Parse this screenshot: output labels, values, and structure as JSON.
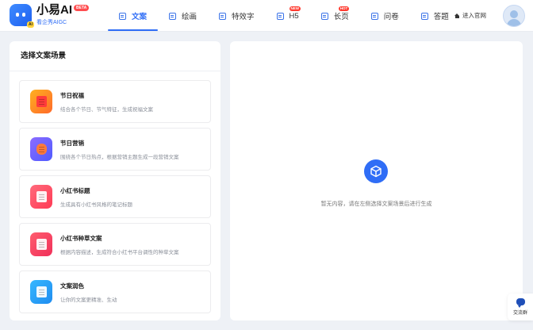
{
  "brand": {
    "name": "小易AI",
    "badge": "BETA",
    "subtitle": "看企秀AIGC",
    "logo_tag": "AI",
    "color": "#2f6df6"
  },
  "nav": [
    {
      "label": "文案",
      "icon": "doc-icon",
      "active": true,
      "badge": ""
    },
    {
      "label": "绘画",
      "icon": "brush-icon",
      "active": false,
      "badge": ""
    },
    {
      "label": "特效字",
      "icon": "text-effect-icon",
      "active": false,
      "badge": ""
    },
    {
      "label": "H5",
      "icon": "h5-icon",
      "active": false,
      "badge": "NEW"
    },
    {
      "label": "长页",
      "icon": "longpage-icon",
      "active": false,
      "badge": "HOT"
    },
    {
      "label": "问卷",
      "icon": "survey-icon",
      "active": false,
      "badge": ""
    },
    {
      "label": "答题",
      "icon": "quiz-icon",
      "active": false,
      "badge": ""
    }
  ],
  "site_link": {
    "label": "进入官网",
    "icon": "home-icon"
  },
  "left_panel": {
    "title": "选择文案场景",
    "cards": [
      {
        "title": "节日祝福",
        "desc": "结合各个节日、节气特征，生成祝福文案",
        "icon": "red-envelope-icon",
        "colors": [
          "#ffb020",
          "#ff6a2a"
        ]
      },
      {
        "title": "节日营销",
        "desc": "围绕各个节日热点，根据营销主题生成一段营销文案",
        "icon": "lantern-icon",
        "colors": [
          "#8b6cff",
          "#4f5bff"
        ]
      },
      {
        "title": "小红书标题",
        "desc": "生成具有小红书风格的笔记标题",
        "icon": "note-title-icon",
        "colors": [
          "#ff6b7c",
          "#ff3a55"
        ]
      },
      {
        "title": "小红书种草文案",
        "desc": "根据内容描述，生成符合小红书平台调性的种草文案",
        "icon": "heart-note-icon",
        "colors": [
          "#ff5d6e",
          "#f0305a"
        ]
      },
      {
        "title": "文案润色",
        "desc": "让你的文案更精准、生动",
        "icon": "polish-icon",
        "colors": [
          "#36b8ff",
          "#1f8cf0"
        ]
      }
    ]
  },
  "right_panel": {
    "empty_text": "暂无内容，请在左侧选择文案场景后进行生成",
    "icon": "box-icon"
  },
  "float_button": {
    "label": "交流群",
    "icon": "chat-icon"
  }
}
